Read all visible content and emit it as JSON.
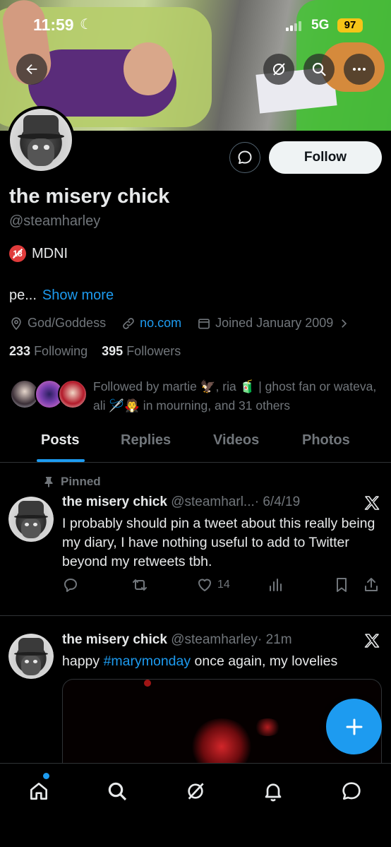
{
  "status_bar": {
    "time": "11:59",
    "network": "5G",
    "battery": "97"
  },
  "profile": {
    "name": "the misery chick",
    "handle": "@steamharley",
    "bio_line1": "MDNI",
    "bio_line2": "pe...",
    "show_more": "Show more",
    "location": "God/Goddess",
    "website": "no.com",
    "joined": "Joined January 2009",
    "following_count": "233",
    "following_label": "Following",
    "followers_count": "395",
    "followers_label": "Followers",
    "followed_by": "Followed by martie 🦅, ria 🧃 | ghost fan or wateva, ali 🪡🧛 in mourning, and 31 others",
    "follow_label": "Follow"
  },
  "tabs": [
    {
      "label": "Posts"
    },
    {
      "label": "Replies"
    },
    {
      "label": "Videos"
    },
    {
      "label": "Photos"
    }
  ],
  "posts": [
    {
      "pinned_label": "Pinned",
      "name": "the misery chick",
      "handle": "@steamharl...",
      "time": "· 6/4/19",
      "text": "I probably should pin a tweet about this really being my diary, I have nothing useful to add to Twitter beyond my retweets tbh.",
      "likes": "14"
    },
    {
      "name": "the misery chick",
      "handle": "@steamharley",
      "time": "· 21m",
      "text_before": "happy ",
      "hashtag": "#marymonday",
      "text_after": " once again, my lovelies"
    }
  ],
  "colors": {
    "accent": "#1d9bf0",
    "battery": "#f5c518"
  }
}
